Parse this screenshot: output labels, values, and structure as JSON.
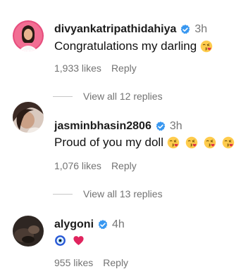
{
  "comments": [
    {
      "username": "divyankatripathidahiya",
      "time": "3h",
      "text": "Congratulations my darling",
      "likes": "1,933 likes",
      "reply": "Reply",
      "view_replies": "View all 12 replies",
      "emoji": [
        "kissing-face-heart"
      ]
    },
    {
      "username": "jasminbhasin2806",
      "time": "3h",
      "text": "Proud of you my doll",
      "likes": "1,076 likes",
      "reply": "Reply",
      "view_replies": "View all 13 replies",
      "emoji": [
        "kissing-face-heart",
        "kissing-face-heart",
        "kissing-face-heart",
        "kissing-face-heart"
      ]
    },
    {
      "username": "alygoni",
      "time": "4h",
      "text": "",
      "likes": "955 likes",
      "reply": "Reply",
      "emoji": [
        "nazar-amulet",
        "red-heart"
      ]
    }
  ],
  "colors": {
    "verified_badge": "#3897f0",
    "secondary_text": "#737373",
    "heart": "#e0245e"
  }
}
